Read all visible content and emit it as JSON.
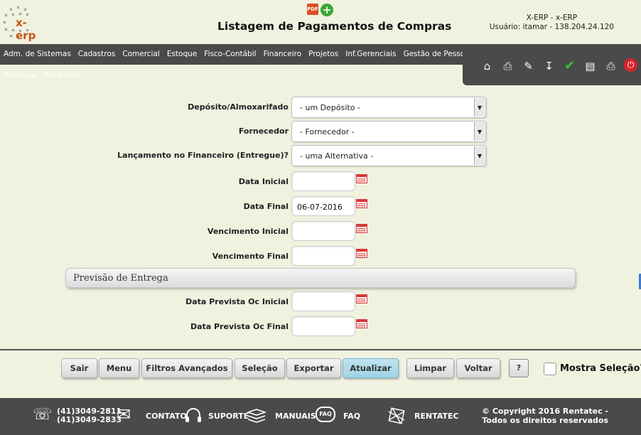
{
  "header": {
    "logo_text": "x-erp",
    "pdf_icon_label": "PDF",
    "title": "Listagem de Pagamentos de Compras",
    "system_name": "X-ERP - x-ERP",
    "user_info": "Usuário: itamar - 138.204.24.120"
  },
  "menu": {
    "items": [
      "Adm. de Sistemas",
      "Cadastros",
      "Comercial",
      "Estoque",
      "Fisco-Contábil",
      "Financeiro",
      "Projetos",
      "Inf.Gerenciais",
      "Gestão de Pessoas"
    ],
    "sub_items": [
      "Produção",
      "Relatórios"
    ]
  },
  "toolbar": {
    "icons": [
      "home-icon",
      "scanner-icon",
      "edit-document-icon",
      "import-icon",
      "check-icon",
      "new-document-icon",
      "print-icon",
      "power-icon"
    ]
  },
  "form": {
    "deposito": {
      "label": "Depósito/Almoxarifado",
      "value": "- um Depósito -"
    },
    "fornecedor": {
      "label": "Fornecedor",
      "value": "- Fornecedor -"
    },
    "lancamento": {
      "label": "Lançamento no Financeiro (Entregue)?",
      "value": "- uma Alternativa -"
    },
    "data_inicial": {
      "label": "Data Inicial",
      "value": ""
    },
    "data_final": {
      "label": "Data Final",
      "value": "06-07-2016"
    },
    "venc_inicial": {
      "label": "Vencimento Inicial",
      "value": ""
    },
    "venc_final": {
      "label": "Vencimento Final",
      "value": ""
    },
    "section_title": "Previsão de Entrega",
    "prev_inicial": {
      "label": "Data Prevista Oc Inicial",
      "value": ""
    },
    "prev_final": {
      "label": "Data Prevista Oc Final",
      "value": ""
    }
  },
  "buttons": {
    "sair": "Sair",
    "menu": "Menu",
    "filtros": "Filtros Avançados",
    "selecao": "Seleção",
    "exportar": "Exportar",
    "atualizar": "Atualizar",
    "limpar": "Limpar",
    "voltar": "Voltar",
    "help": "?",
    "mostra_selecao": "Mostra Seleção?"
  },
  "footer": {
    "phone1": "(41)3049-2811",
    "phone2": "(41)3049-2833",
    "contato": "CONTATO",
    "suporte": "SUPORTE",
    "manuais": "MANUAIS",
    "faq_badge": "FAQ",
    "faq": "FAQ",
    "rentatec": "RENTATEC",
    "copyright": "© Copyright 2016 Rentatec - Todos os direitos reservados"
  },
  "colors": {
    "background": "#f0f1df",
    "bar": "#4a4a4a",
    "active_button": "#9fd3e6",
    "logo_accent": "#c25a18"
  }
}
